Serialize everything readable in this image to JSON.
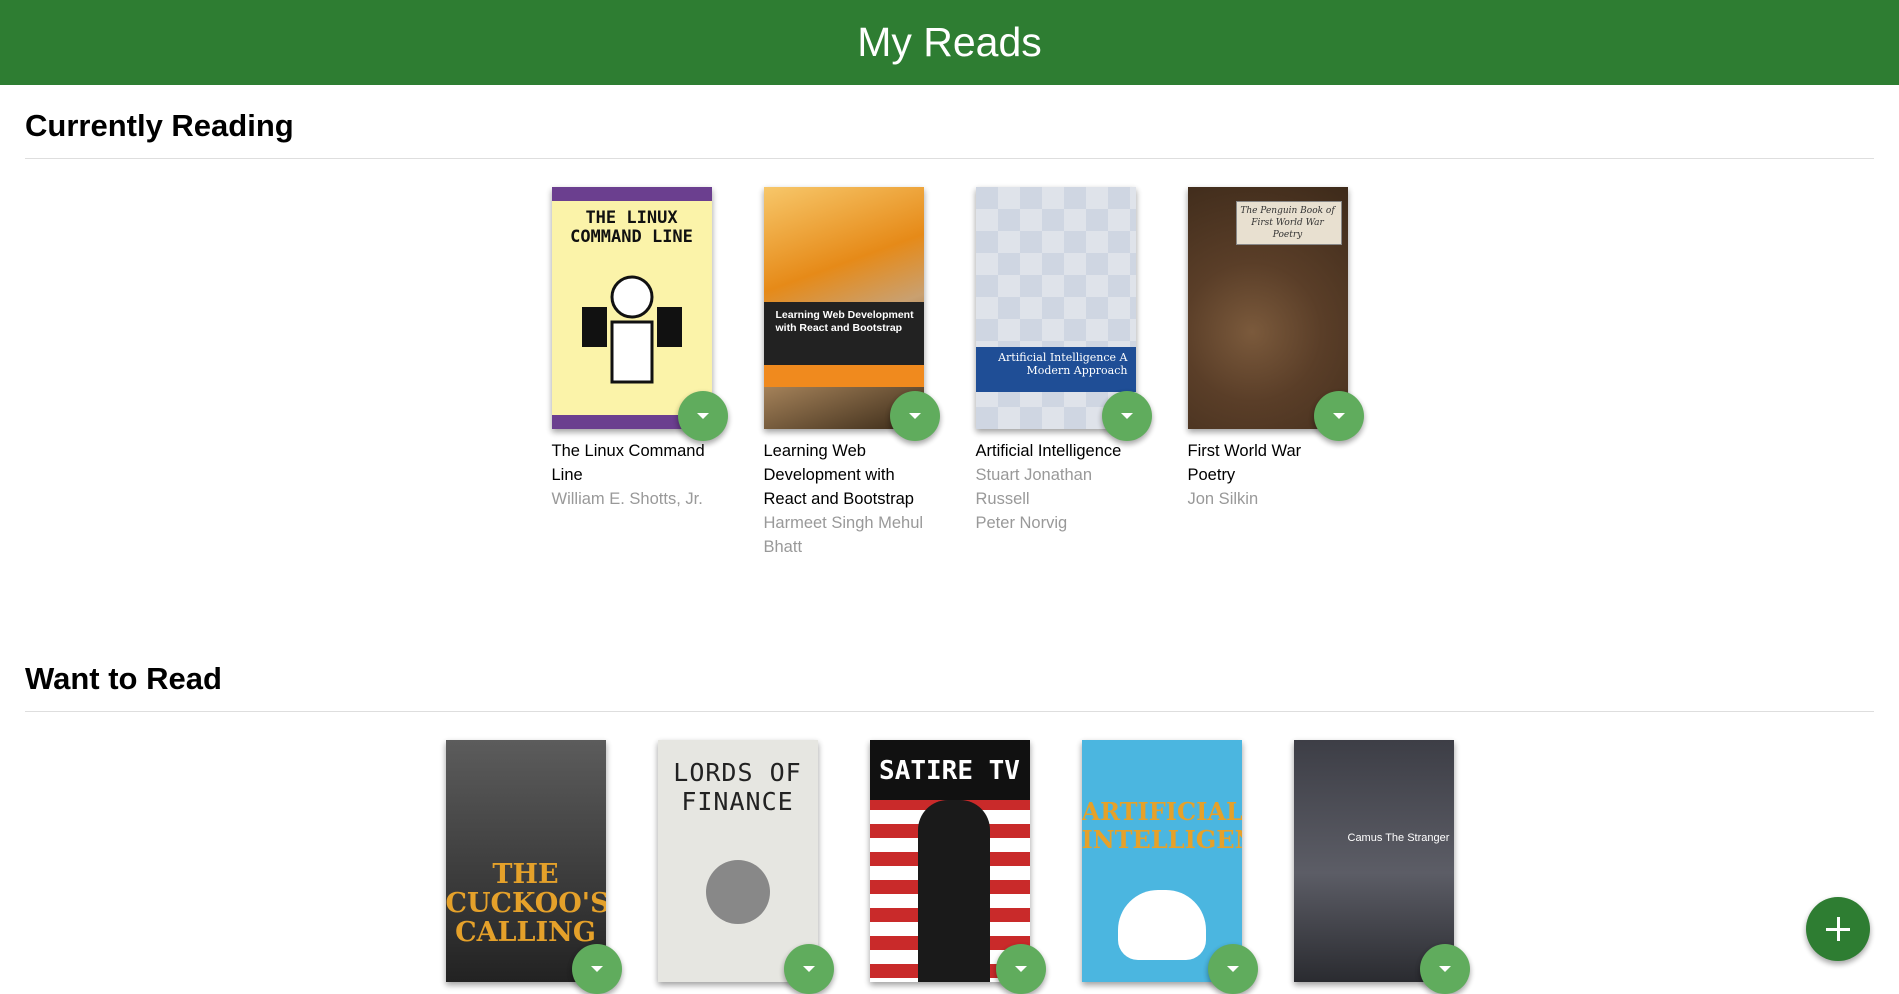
{
  "app": {
    "title": "My Reads"
  },
  "shelves": [
    {
      "title": "Currently Reading",
      "books": [
        {
          "title": "The Linux Command Line",
          "authors": [
            "William E. Shotts, Jr."
          ],
          "cover_text": "THE LINUX COMMAND LINE"
        },
        {
          "title": "Learning Web Development with React and Bootstrap",
          "authors": [
            "Harmeet Singh Mehul Bhatt"
          ],
          "cover_text": "Learning Web Development with React and Bootstrap"
        },
        {
          "title": "Artificial Intelligence",
          "authors": [
            "Stuart Jonathan Russell",
            "Peter Norvig"
          ],
          "cover_text": "Artificial Intelligence A Modern Approach"
        },
        {
          "title": "First World War Poetry",
          "authors": [
            "Jon Silkin"
          ],
          "cover_text": "The Penguin Book of First World War Poetry"
        }
      ]
    },
    {
      "title": "Want to Read",
      "books": [
        {
          "cover_text": "THE CUCKOO'S CALLING"
        },
        {
          "cover_text": "LORDS OF FINANCE"
        },
        {
          "cover_text": "SATIRE TV"
        },
        {
          "cover_text": "ARTIFICIAL INTELLIGENCE"
        },
        {
          "cover_text": "Camus The Stranger"
        }
      ]
    }
  ],
  "colors": {
    "header": "#2e7d32",
    "shelf_changer": "#60ac5d",
    "author_text": "#999999"
  },
  "icons": {
    "shelf_changer": "triangle-down-icon",
    "add": "plus-icon"
  }
}
